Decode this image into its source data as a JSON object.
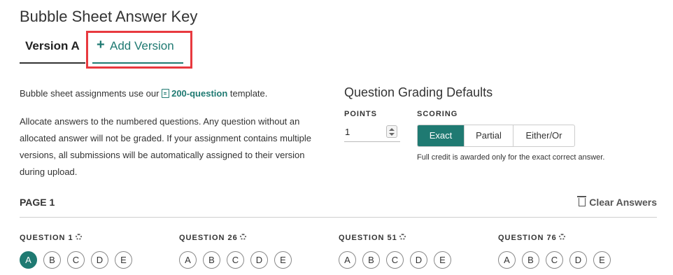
{
  "page_title": "Bubble Sheet Answer Key",
  "tabs": {
    "version_a": "Version A",
    "add_icon": "plus-icon",
    "add_version": "Add Version"
  },
  "info": {
    "line1_prefix": "Bubble sheet assignments use our",
    "template_link": "200-question",
    "line1_suffix": "template.",
    "paragraph": "Allocate answers to the numbered questions. Any question without an allocated answer will not be graded. If your assignment contains multiple versions, all submissions will be automatically assigned to their version during upload."
  },
  "grading": {
    "title": "Question Grading Defaults",
    "points_label": "POINTS",
    "points_value": "1",
    "scoring_label": "SCORING",
    "scoring_options": [
      "Exact",
      "Partial",
      "Either/Or"
    ],
    "scoring_selected": "Exact",
    "scoring_help": "Full credit is awarded only for the exact correct answer."
  },
  "page": {
    "heading": "PAGE 1",
    "clear_label": "Clear Answers"
  },
  "questions": [
    {
      "label": "QUESTION 1",
      "options": [
        "A",
        "B",
        "C",
        "D",
        "E"
      ],
      "selected": "A"
    },
    {
      "label": "QUESTION 26",
      "options": [
        "A",
        "B",
        "C",
        "D",
        "E"
      ],
      "selected": null
    },
    {
      "label": "QUESTION 51",
      "options": [
        "A",
        "B",
        "C",
        "D",
        "E"
      ],
      "selected": null
    },
    {
      "label": "QUESTION 76",
      "options": [
        "A",
        "B",
        "C",
        "D",
        "E"
      ],
      "selected": null
    }
  ],
  "colors": {
    "accent": "#1f7a72",
    "highlight": "#e8393f"
  }
}
